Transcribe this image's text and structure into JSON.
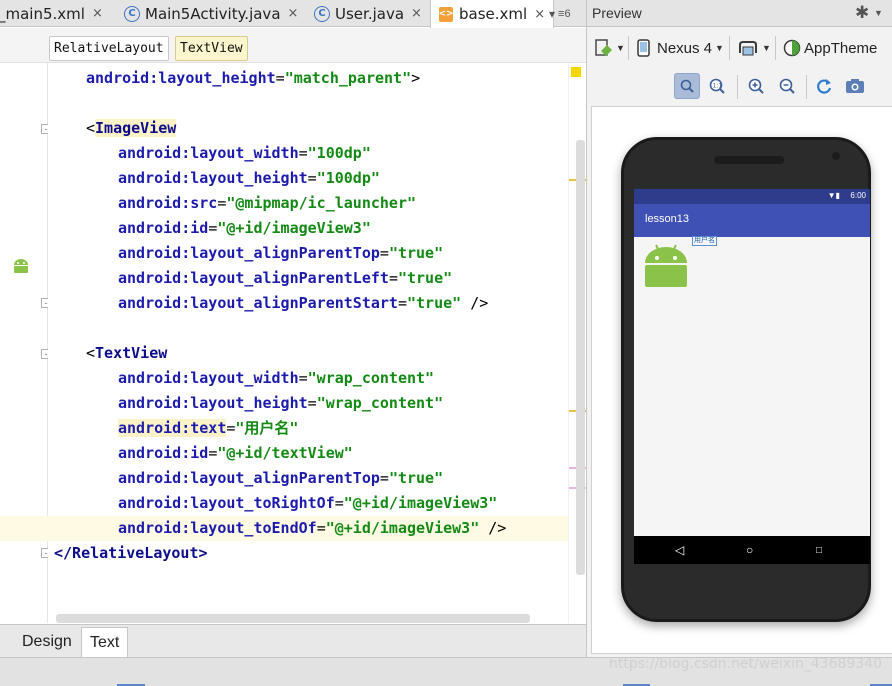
{
  "tabs": [
    {
      "label": "_main5.xml",
      "type": "xml"
    },
    {
      "label": "Main5Activity.java",
      "type": "java"
    },
    {
      "label": "User.java",
      "type": "java"
    },
    {
      "label": "base.xml",
      "type": "xml",
      "active": true
    }
  ],
  "tab_close_glyph": "×",
  "tab_overflow": {
    "count": "≡6"
  },
  "breadcrumb": [
    "RelativeLayout",
    "TextView"
  ],
  "code_lines": [
    {
      "i1": "android:layout_height",
      "v": "\"match_parent\"",
      "end": ">"
    },
    {
      "open": "<",
      "tag": "ImageView"
    },
    {
      "a": "android:layout_width",
      "v": "\"100dp\""
    },
    {
      "a": "android:layout_height",
      "v": "\"100dp\""
    },
    {
      "a": "android:src",
      "v": "\"@mipmap/ic_launcher\""
    },
    {
      "a": "android:id",
      "v": "\"@+id/imageView3\""
    },
    {
      "a": "android:layout_alignParentTop",
      "v": "\"true\""
    },
    {
      "a": "android:layout_alignParentLeft",
      "v": "\"true\""
    },
    {
      "a": "android:layout_alignParentStart",
      "v": "\"true\"",
      "end": " />"
    },
    {
      "open": "<",
      "tag": "TextView"
    },
    {
      "a": "android:layout_width",
      "v": "\"wrap_content\""
    },
    {
      "a": "android:layout_height",
      "v": "\"wrap_content\""
    },
    {
      "a": "android:text",
      "v": "\"用户名\""
    },
    {
      "a": "android:id",
      "v": "\"@+id/textView\""
    },
    {
      "a": "android:layout_alignParentTop",
      "v": "\"true\""
    },
    {
      "a": "android:layout_toRightOf",
      "v": "\"@+id/imageView3\""
    },
    {
      "a": "android:layout_toEndOf",
      "v": "\"@+id/imageView3\"",
      "end": " />"
    },
    {
      "close": "</RelativeLayout>"
    }
  ],
  "bottom_tabs": [
    "Design",
    "Text"
  ],
  "preview": {
    "title": "Preview",
    "device": "Nexus 4",
    "theme": "AppTheme",
    "phone": {
      "status_time": "6:00",
      "app_title": "lesson13",
      "text_view": "用户名"
    }
  },
  "watermark": "https://blog.csdn.net/weixin_43689340",
  "colors": {
    "app_bar": "#3f51b5",
    "status_bar": "#2d3d8c",
    "attr": "#1c1cac",
    "value": "#138a13",
    "highlight": "#fbf2c8"
  }
}
